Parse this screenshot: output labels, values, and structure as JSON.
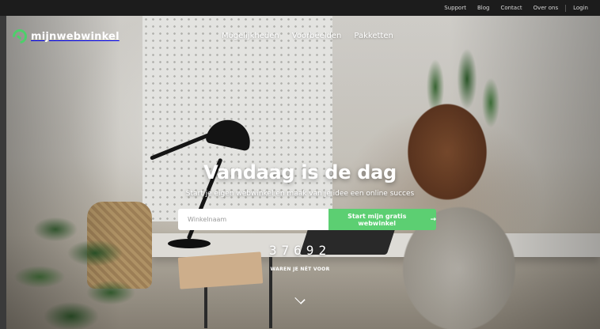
{
  "topbar": {
    "links": [
      "Support",
      "Blog",
      "Contact",
      "Over ons",
      "Login"
    ]
  },
  "header": {
    "logo_text": "mijnwebwinkel",
    "menu": [
      "Mogelijkheden",
      "Voorbeelden",
      "Pakketten"
    ]
  },
  "hero": {
    "title": "Vandaag is de dag",
    "subtitle": "Start je eigen webwinkel en maak van je idee een online succes",
    "input_placeholder": "Winkelnaam",
    "cta_label": "Start mijn gratis webwinkel",
    "counter": "37692",
    "counter_label": "WAREN JE NÉT VOOR"
  },
  "colors": {
    "accent": "#5ccf72",
    "topbar": "#1c1c1c"
  },
  "icons": [
    "logo-icon",
    "arrow-right-icon",
    "chevron-down-icon"
  ]
}
